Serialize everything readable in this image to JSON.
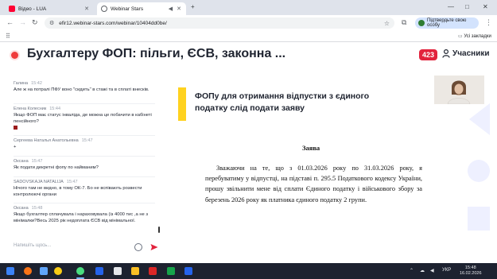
{
  "browser": {
    "tabs": [
      {
        "label": "Відео - LUA",
        "favicon_color": "#ff0033",
        "active": false
      },
      {
        "label": "Webinar Stars",
        "favicon_color": "#5f6368",
        "active": true
      }
    ],
    "new_tab": "+",
    "window_controls": [
      "—",
      "□",
      "✕"
    ],
    "url": "efir12.webinar-stars.com/webinar/10404dd0be/",
    "profile_button": "Підтвердьте свою особу",
    "bookmarks_folder": "Усі закладки"
  },
  "webinar": {
    "title": "Бухгалтеру ФОП: пільги, ЄСВ, законна ...",
    "participant_count": "423",
    "participants_label": "Учасники"
  },
  "chat": {
    "messages": [
      {
        "author": "Галина",
        "time": "15:42",
        "text": "Але ж на потралі ПФУ воно \"сидить\" в стажі та в сплаті внесків."
      },
      {
        "author": "Елена Колесник",
        "time": "15:44",
        "text": "Якщо ФОП має статус інваліда, де можна це побачити в кабінеті пенсійного?"
      },
      {
        "author": "Сергеева Наталья Анатольевна",
        "time": "15:47",
        "text": "+"
      },
      {
        "author": "Оксана",
        "time": "15:47",
        "text": "Як подати декретні фопу по найманим?"
      },
      {
        "author": "SADOVSKAJA NATALIJA",
        "time": "15:47",
        "text": "Нічого там не видно, в тому ОК-7. Бо не вспівають розвести контролюючі органи"
      },
      {
        "author": "Оксана",
        "time": "15:48",
        "text": "Якщо бухгалтер сплачувала і нараховувала (із 4000 тис ,а не з мінімалки?Весь 2025 рік недоплата ЄСВ від мінімальної."
      }
    ],
    "input_placeholder": "Напишіть щось..."
  },
  "slide": {
    "title": "ФОПу для отримання відпустки з єдиного податку слід подати заяву",
    "heading": "Заява",
    "body": "Зважаючи на те, що з 01.03.2026 року по 31.03.2026 року, я перебуватиму у відпустці, на підставі п. 295.5 Податкового кодексу України, прошу звільнити мене від сплати Єдиного податку і військового збору за березень 2026 року як платника єдиного податку 2 групи.",
    "accent_color": "#ffd21f"
  },
  "taskbar": {
    "language": "УКР",
    "time": "15:48",
    "date": "16.02.2026"
  },
  "colors": {
    "live": "#ef3b3b",
    "badge": "#e2233d",
    "send": "#e2233d"
  }
}
